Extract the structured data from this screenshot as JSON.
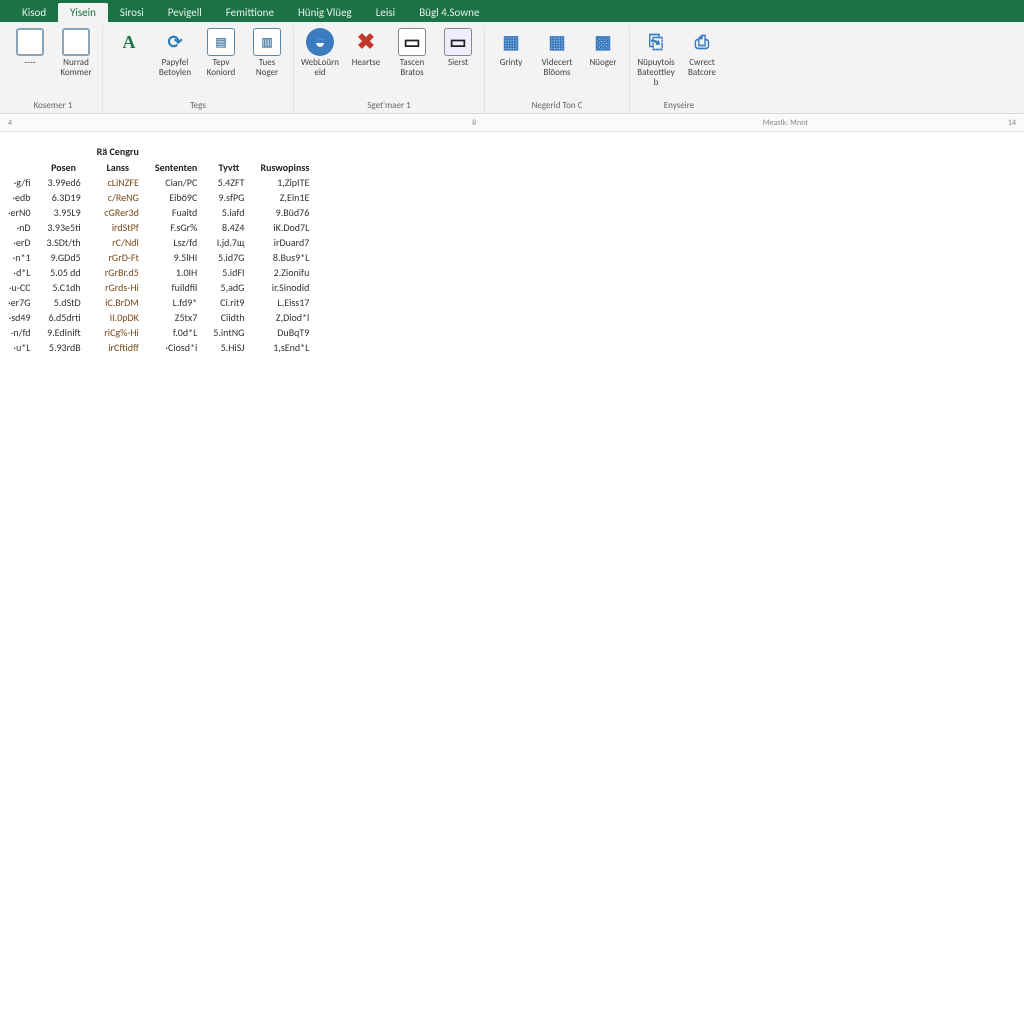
{
  "tabs": [
    "Kisod",
    "Yisein",
    "Sirosi",
    "Pevigell",
    "Femittione",
    "Hünig Vlüeg",
    "Leisi",
    "Bügl 4.Sowne"
  ],
  "active_tab_index": 1,
  "ribbon": {
    "groups": [
      {
        "label": "Kosemer 1",
        "buttons": [
          {
            "name": "themes-button",
            "icon": "palette-icon",
            "label": "----"
          },
          {
            "name": "fonts-button",
            "icon": "border-icon",
            "label": "Nurrad Kommer"
          }
        ]
      },
      {
        "label": "Tegs",
        "buttons": [
          {
            "name": "font-a-button",
            "icon": "letter-a-icon",
            "label": "A"
          },
          {
            "name": "refresh-button",
            "icon": "refresh-icon",
            "label": "Papyfel Betoylen"
          },
          {
            "name": "page-button",
            "icon": "doc-icon",
            "label": "Tepv Koniord"
          },
          {
            "name": "page2-button",
            "icon": "doc-icon",
            "label": "Tues Noger"
          }
        ]
      },
      {
        "label": "Sget'maer 1",
        "buttons": [
          {
            "name": "web-button",
            "icon": "globe-icon",
            "label": "WebLoürneid"
          },
          {
            "name": "delete-button",
            "icon": "x-icon",
            "label": "Heartse"
          },
          {
            "name": "window-button",
            "icon": "window-icon",
            "label": "Tascen Bratos"
          },
          {
            "name": "window2-button",
            "icon": "window2-icon",
            "label": "Sierst"
          }
        ]
      },
      {
        "label": "Negerid Ton C",
        "buttons": [
          {
            "name": "arrange-button",
            "icon": "arrange-icon",
            "label": "Grinty"
          },
          {
            "name": "arrange2-button",
            "icon": "arrange-icon",
            "label": "Videcert Blöoms"
          },
          {
            "name": "arrange3-button",
            "icon": "arrange2-icon",
            "label": "Nüoger"
          }
        ]
      },
      {
        "label": "Enyseire",
        "buttons": [
          {
            "name": "clip-button",
            "icon": "clip-icon",
            "label": "Nüpuytois Bateottieyb"
          },
          {
            "name": "clip2-button",
            "icon": "clip-icon",
            "label": "Cwrect Batcore"
          }
        ]
      }
    ]
  },
  "ruler": {
    "left": "4",
    "mid": "8",
    "right_label": "Measſk: Mnnt",
    "right": "14"
  },
  "section_title": "Rä Cengru",
  "columns": [
    "",
    "Posen",
    "Lanss",
    "Sententen",
    "Tyvtt",
    "Ruswopinss"
  ],
  "rows": [
    [
      "·g/fi",
      "3.99ed6",
      "cLiNZFE",
      "Cian/PC",
      "5.4ZFT",
      "1,ZipITE"
    ],
    [
      "·edb",
      "6.3D19",
      "c/ReNG",
      "Eibö9C",
      "9.sfPG",
      "Z,Ein1E"
    ],
    [
      "·erN0",
      "3.95L9",
      "cGRer3d",
      "Fuaitd",
      "5.iafd",
      "9.Büd76"
    ],
    [
      "·nD",
      "3.93e5ti",
      "irdStPf",
      "F.sGr%",
      "8.4Z4",
      "iK.Dod7L"
    ],
    [
      "·erD",
      "3.SDt/th",
      "rC/Ndl",
      "Lsz/fd",
      "I.jd.7щ",
      "irDuard7"
    ],
    [
      "·n*1",
      "9.GDd5",
      "rGrD-Ft",
      "9.5lHI",
      "5.id7G",
      "8.Bus9*L"
    ],
    [
      "·d*L",
      "5.05 dd",
      "rGrBr.d5",
      "1.0IH",
      "5.idFI",
      "2.Zionifu"
    ],
    [
      "·u-CC",
      "5.C1dh",
      "rGrds-Hi",
      "fuildfil",
      "5,adG",
      "ir.Sinodid"
    ],
    [
      "·er7G",
      "5.dStD",
      "iC.BrDM",
      "L.fd9*",
      "Ci.rit9",
      "L,Eiss17"
    ],
    [
      "·sd49",
      "6.d5drti",
      "II.0pDK",
      "Z5tx7",
      "Ciidth",
      "Z,Diod*l"
    ],
    [
      "·n/fd",
      "9.Edinift",
      "riCg%-Hi",
      "f.0d*L",
      "5.intNG",
      "DuBqT9"
    ],
    [
      "·u*L",
      "5.93rdB",
      "irCftidff",
      "·Ciosd*i",
      "5.HiSJ",
      "1,sEnd*L"
    ]
  ]
}
